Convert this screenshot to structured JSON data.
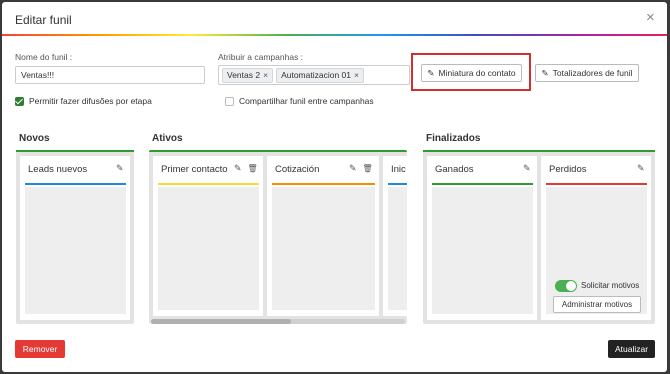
{
  "modal": {
    "title": "Editar funil",
    "close_icon": "×"
  },
  "form": {
    "funnel_name_label": "Nome do funil :",
    "funnel_name_value": "Ventas!!!",
    "campaigns_label": "Atribuir a campanhas :",
    "campaign_tags": [
      "Ventas 2",
      "Automatizacion 01"
    ],
    "tag_remove": "×",
    "thumbnail_button": "Miniatura do contato",
    "totals_button": "Totalizadores de funil",
    "allow_broadcasts_label": "Permitir fazer difusões por etapa",
    "allow_broadcasts_checked": true,
    "share_funnel_label": "Compartilhar funil entre campanhas",
    "share_funnel_checked": false
  },
  "groups": {
    "novos": {
      "title": "Novos",
      "columns": [
        {
          "name": "Leads nuevos",
          "color": "#1e88e5"
        }
      ]
    },
    "ativos": {
      "title": "Ativos",
      "columns": [
        {
          "name": "Primer contacto",
          "color": "#fdd835"
        },
        {
          "name": "Cotización",
          "color": "#fb8c00"
        },
        {
          "name": "Inic",
          "color": "#1e88e5"
        }
      ]
    },
    "finalizados": {
      "title": "Finalizados",
      "columns": [
        {
          "name": "Ganados",
          "color": "#2e9c2e"
        },
        {
          "name": "Perdidos",
          "color": "#e53935"
        }
      ],
      "request_reasons_label": "Solicitar motivos",
      "request_reasons_on": true,
      "manage_reasons_button": "Administrar motivos"
    },
    "group_bar_color": "#2e9c2e"
  },
  "footer": {
    "remove_button": "Remover",
    "update_button": "Atualizar"
  }
}
